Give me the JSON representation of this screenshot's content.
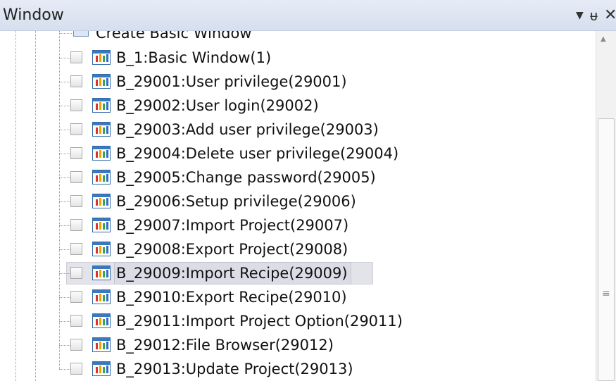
{
  "panel": {
    "title": "Window",
    "controls": {
      "dropdown": "▼",
      "pin": "ῥ",
      "close": "✕"
    }
  },
  "tree": {
    "parent_label": "Create Basic Window",
    "selected_index": 9,
    "items": [
      {
        "label": "B_1:Basic Window(1)",
        "checked": false
      },
      {
        "label": "B_29001:User privilege(29001)",
        "checked": false
      },
      {
        "label": "B_29002:User login(29002)",
        "checked": false
      },
      {
        "label": "B_29003:Add user privilege(29003)",
        "checked": false
      },
      {
        "label": "B_29004:Delete user privilege(29004)",
        "checked": false
      },
      {
        "label": "B_29005:Change password(29005)",
        "checked": false
      },
      {
        "label": "B_29006:Setup privilege(29006)",
        "checked": false
      },
      {
        "label": "B_29007:Import Project(29007)",
        "checked": false
      },
      {
        "label": "B_29008:Export Project(29008)",
        "checked": false
      },
      {
        "label": "B_29009:Import Recipe(29009)",
        "checked": false
      },
      {
        "label": "B_29010:Export Recipe(29010)",
        "checked": false
      },
      {
        "label": "B_29011:Import Project Option(29011)",
        "checked": false
      },
      {
        "label": "B_29012:File Browser(29012)",
        "checked": false
      },
      {
        "label": "B_29013:Update Project(29013)",
        "checked": false
      }
    ]
  },
  "icons": {
    "window_item": "window-chart-icon",
    "parent_folder": "window-folder-icon"
  },
  "colors": {
    "titlebar": "#dde5f2",
    "selection": "#e3e3ea"
  }
}
